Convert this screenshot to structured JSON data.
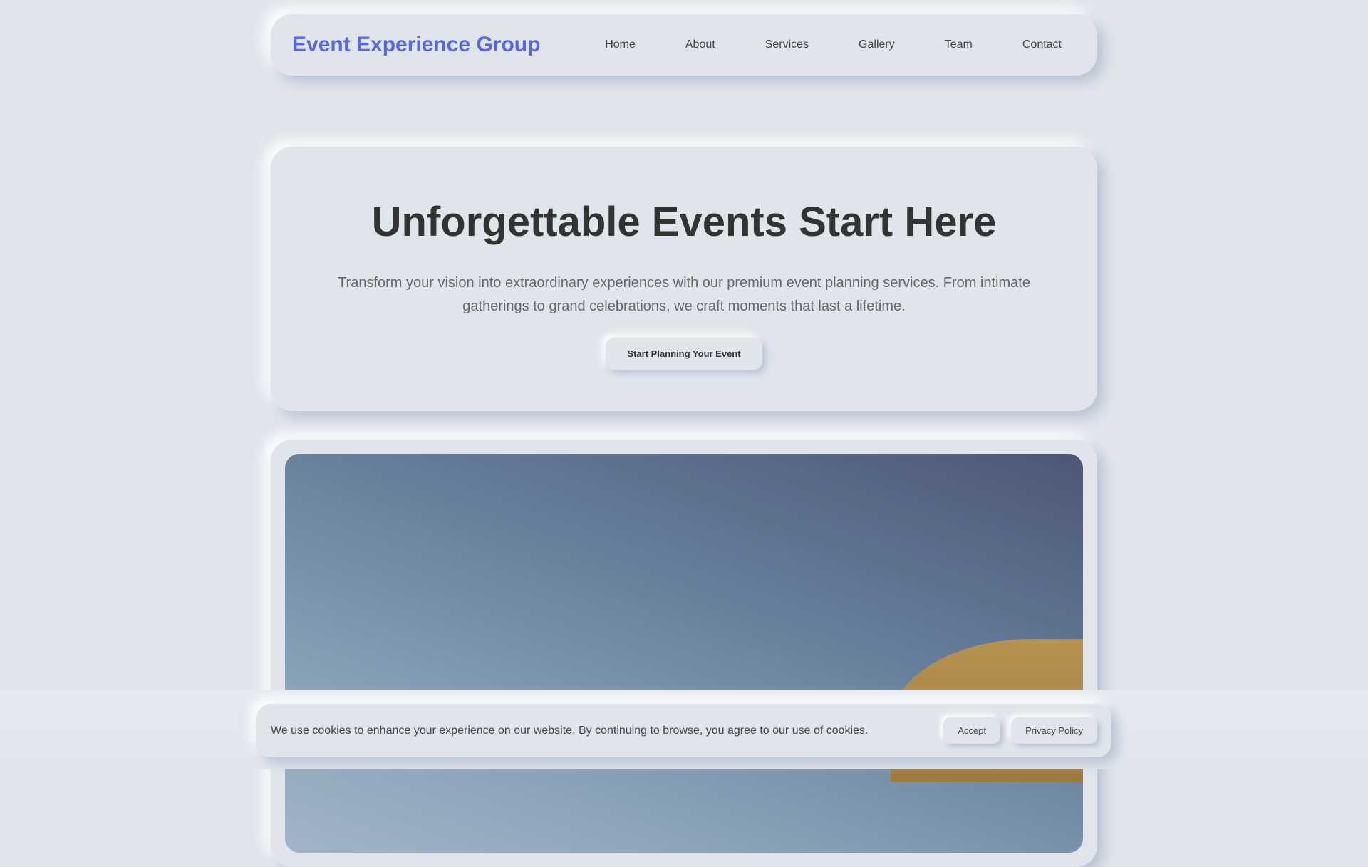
{
  "nav": {
    "logo": "Event Experience Group",
    "links": [
      "Home",
      "About",
      "Services",
      "Gallery",
      "Team",
      "Contact"
    ]
  },
  "hero": {
    "title": "Unforgettable Events Start Here",
    "text": "Transform your vision into extraordinary experiences with our premium event planning services. From intimate gatherings to grand celebrations, we craft moments that last a lifetime.",
    "cta": "Start Planning Your Event"
  },
  "cookie": {
    "text": "We use cookies to enhance your experience on our website. By continuing to browse, you agree to our use of cookies.",
    "accept": "Accept",
    "privacy": "Privacy Policy"
  },
  "colors": {
    "accent": "#5a67d8",
    "background": "#e0e5ec"
  }
}
